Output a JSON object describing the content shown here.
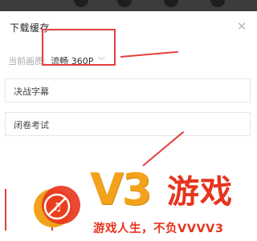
{
  "header": {
    "title": "下载缓存",
    "close_icon": "close-icon"
  },
  "quality": {
    "label": "当前画质:",
    "value": "流畅 360P",
    "icon": "chevron-down-icon"
  },
  "videos": [
    {
      "title": "决战字幕"
    },
    {
      "title": "闭卷考试"
    }
  ],
  "watermark": {
    "brand": "V3",
    "brand_suffix": "游戏",
    "slogan": "游戏人生，不负VVVV3",
    "logo_icon": "music-note-ban-logo"
  },
  "colors": {
    "highlight": "#e1403f",
    "brand_orange": "#f2a21b",
    "brand_red": "#e8341e"
  }
}
